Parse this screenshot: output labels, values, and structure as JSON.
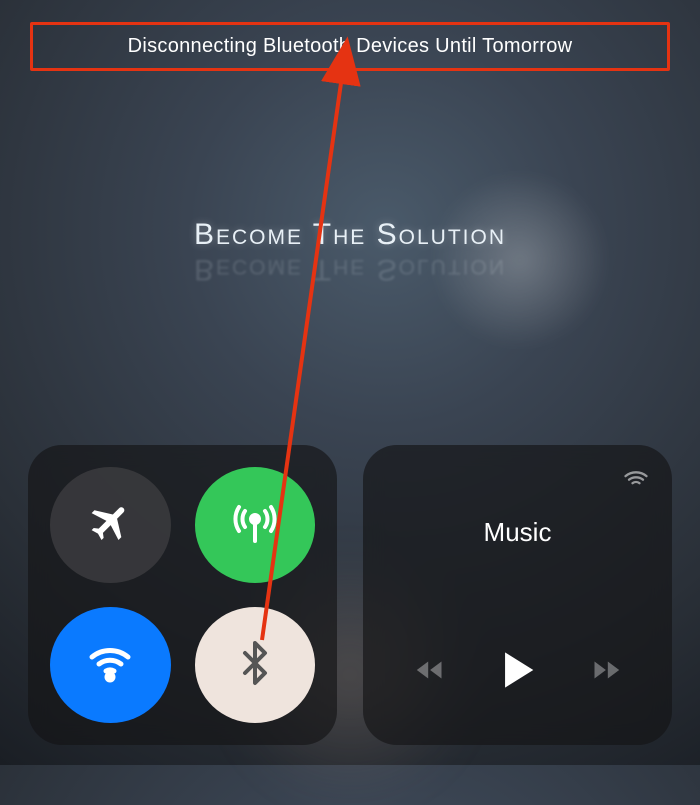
{
  "banner": {
    "text": "Disconnecting Bluetooth Devices Until Tomorrow"
  },
  "watermark": {
    "text": "Become The Solution"
  },
  "connectivity": {
    "airplane": {
      "icon": "airplane-icon",
      "active": false
    },
    "cellular": {
      "icon": "antenna-icon",
      "active": true
    },
    "wifi": {
      "icon": "wifi-icon",
      "active": true
    },
    "bluetooth": {
      "icon": "bluetooth-icon",
      "active": false
    }
  },
  "music": {
    "title": "Music",
    "controls": {
      "prev": "prev-icon",
      "play": "play-icon",
      "next": "next-icon"
    }
  },
  "annotation": {
    "color": "#e53312"
  }
}
